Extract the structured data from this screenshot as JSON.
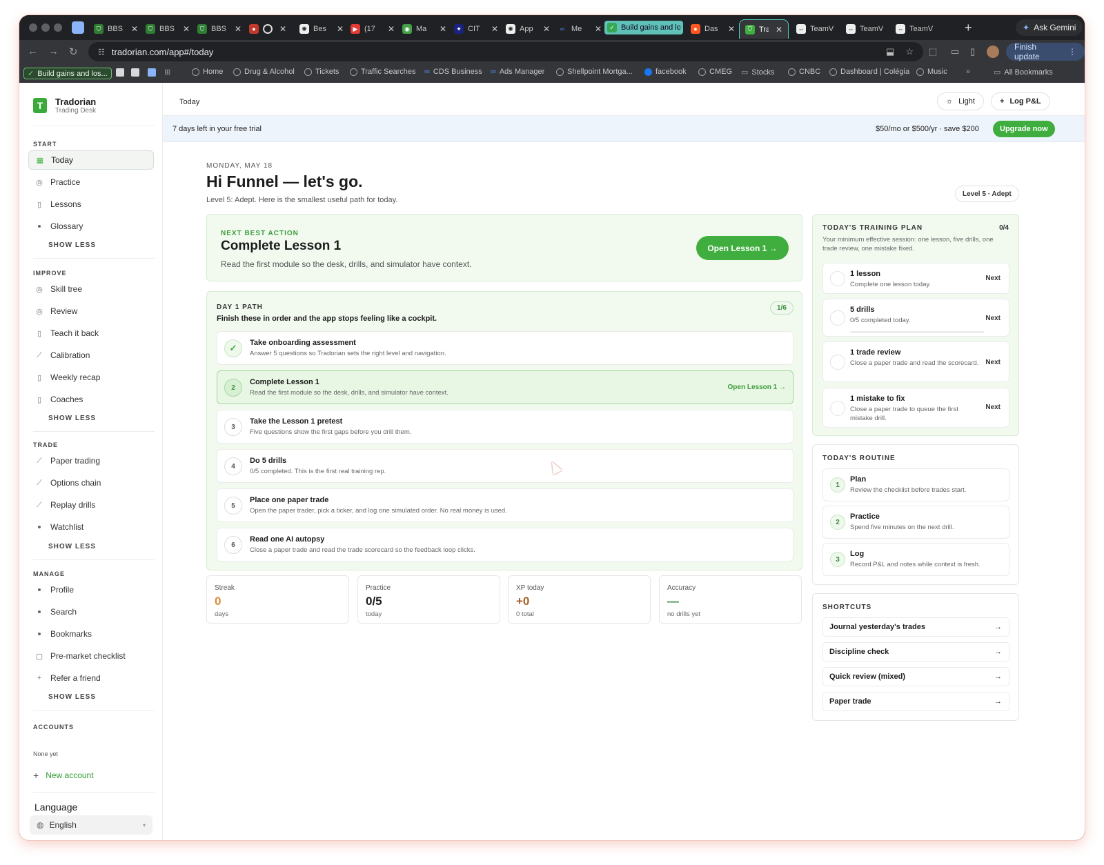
{
  "browser": {
    "tabs": [
      {
        "label": "BBS"
      },
      {
        "label": "BBS"
      },
      {
        "label": "BBS"
      },
      {
        "label": ""
      },
      {
        "label": "Bes"
      },
      {
        "label": "(17"
      },
      {
        "label": "Ma"
      },
      {
        "label": "CIT"
      },
      {
        "label": "App"
      },
      {
        "label": "Me"
      },
      {
        "label": "Build gains and lo"
      },
      {
        "label": "Das"
      },
      {
        "label": "Tra"
      },
      {
        "label": "TeamVi"
      },
      {
        "label": "TeamVi"
      },
      {
        "label": "TeamVi"
      }
    ],
    "ask_gemini": "Ask Gemini",
    "url": "tradorian.com/app#/today",
    "finish_update": "Finish update",
    "bookmarks": [
      "Build gains and los...",
      "Home",
      "Drug & Alcohol",
      "Tickets",
      "Traffic Searches",
      "CDS Business",
      "Ads Manager",
      "Shellpoint Mortga...",
      "facebook",
      "CMEG",
      "Stocks",
      "CNBC",
      "Dashboard | Colégia",
      "Music",
      "All Bookmarks"
    ]
  },
  "sidebar": {
    "brand_name": "Tradorian",
    "brand_sub": "Trading Desk",
    "sections": [
      {
        "title": "START",
        "items": [
          "Today",
          "Practice",
          "Lessons",
          "Glossary"
        ]
      },
      {
        "title": "IMPROVE",
        "items": [
          "Skill tree",
          "Review",
          "Teach it back",
          "Calibration",
          "Weekly recap",
          "Coaches"
        ]
      },
      {
        "title": "TRADE",
        "items": [
          "Paper trading",
          "Options chain",
          "Replay drills",
          "Watchlist"
        ]
      },
      {
        "title": "MANAGE",
        "items": [
          "Profile",
          "Search",
          "Bookmarks",
          "Pre-market checklist",
          "Refer a friend"
        ]
      }
    ],
    "show_less": "SHOW LESS",
    "accounts_title": "ACCOUNTS",
    "accounts_none": "None yet",
    "new_account": "New account",
    "language_title": "Language",
    "language_value": "English"
  },
  "topbar": {
    "breadcrumb": "Today",
    "light": "Light",
    "log_pnl": "Log P&L"
  },
  "trial": {
    "text": "7 days left in your free trial",
    "price": "$50/mo or $500/yr · save $200",
    "upgrade": "Upgrade now"
  },
  "header": {
    "date": "MONDAY, MAY 18",
    "greeting": "Hi Funnel — let's go.",
    "subtitle": "Level 5: Adept. Here is the smallest useful path for today.",
    "level_pill": "Level 5 · Adept"
  },
  "next_action": {
    "kicker": "NEXT BEST ACTION",
    "title": "Complete Lesson 1",
    "desc": "Read the first module so the desk, drills, and simulator have context.",
    "button": "Open Lesson 1 →"
  },
  "day_path": {
    "kicker": "DAY 1 PATH",
    "heading": "Finish these in order and the app stops feeling like a cockpit.",
    "count": "1/6",
    "steps": [
      {
        "marker": "✓",
        "title": "Take onboarding assessment",
        "desc": "Answer 5 questions so Tradorian sets the right level and navigation.",
        "action": ""
      },
      {
        "marker": "2",
        "title": "Complete Lesson 1",
        "desc": "Read the first module so the desk, drills, and simulator have context.",
        "action": "Open Lesson 1 →"
      },
      {
        "marker": "3",
        "title": "Take the Lesson 1 pretest",
        "desc": "Five questions show the first gaps before you drill them.",
        "action": ""
      },
      {
        "marker": "4",
        "title": "Do 5 drills",
        "desc": "0/5 completed. This is the first real training rep.",
        "action": ""
      },
      {
        "marker": "5",
        "title": "Place one paper trade",
        "desc": "Open the paper trader, pick a ticker, and log one simulated order. No real money is used.",
        "action": ""
      },
      {
        "marker": "6",
        "title": "Read one AI autopsy",
        "desc": "Close a paper trade and read the trade scorecard so the feedback loop clicks.",
        "action": ""
      }
    ]
  },
  "stats": [
    {
      "label": "Streak",
      "value": "0",
      "sub": "days"
    },
    {
      "label": "Practice",
      "value": "0/5",
      "sub": "today"
    },
    {
      "label": "XP today",
      "value": "+0",
      "sub": "0 total"
    },
    {
      "label": "Accuracy",
      "value": "—",
      "sub": "no drills yet"
    }
  ],
  "training_plan": {
    "kicker": "TODAY'S TRAINING PLAN",
    "count": "0/4",
    "desc": "Your minimum effective session: one lesson, five drills, one trade review, one mistake fixed.",
    "items": [
      {
        "title": "1 lesson",
        "desc": "Complete one lesson today.",
        "status": "Next"
      },
      {
        "title": "5 drills",
        "desc": "0/5 completed today.",
        "status": "Next",
        "progress": 0
      },
      {
        "title": "1 trade review",
        "desc": "Close a paper trade and read the scorecard.",
        "status": "Next"
      },
      {
        "title": "1 mistake to fix",
        "desc": "Close a paper trade to queue the first mistake drill.",
        "status": "Next"
      }
    ]
  },
  "routine": {
    "kicker": "TODAY'S ROUTINE",
    "items": [
      {
        "n": "1",
        "title": "Plan",
        "desc": "Review the checklist before trades start."
      },
      {
        "n": "2",
        "title": "Practice",
        "desc": "Spend five minutes on the next drill."
      },
      {
        "n": "3",
        "title": "Log",
        "desc": "Record P&L and notes while context is fresh."
      }
    ]
  },
  "shortcuts": {
    "kicker": "SHORTCUTS",
    "items": [
      "Journal yesterday's trades",
      "Discipline check",
      "Quick review (mixed)",
      "Paper trade"
    ]
  },
  "colors": {
    "accent": "#3fae3f",
    "accent_soft": "#f2faf0",
    "trial_bg": "#eef4fb",
    "streak": "#d98a3a"
  }
}
